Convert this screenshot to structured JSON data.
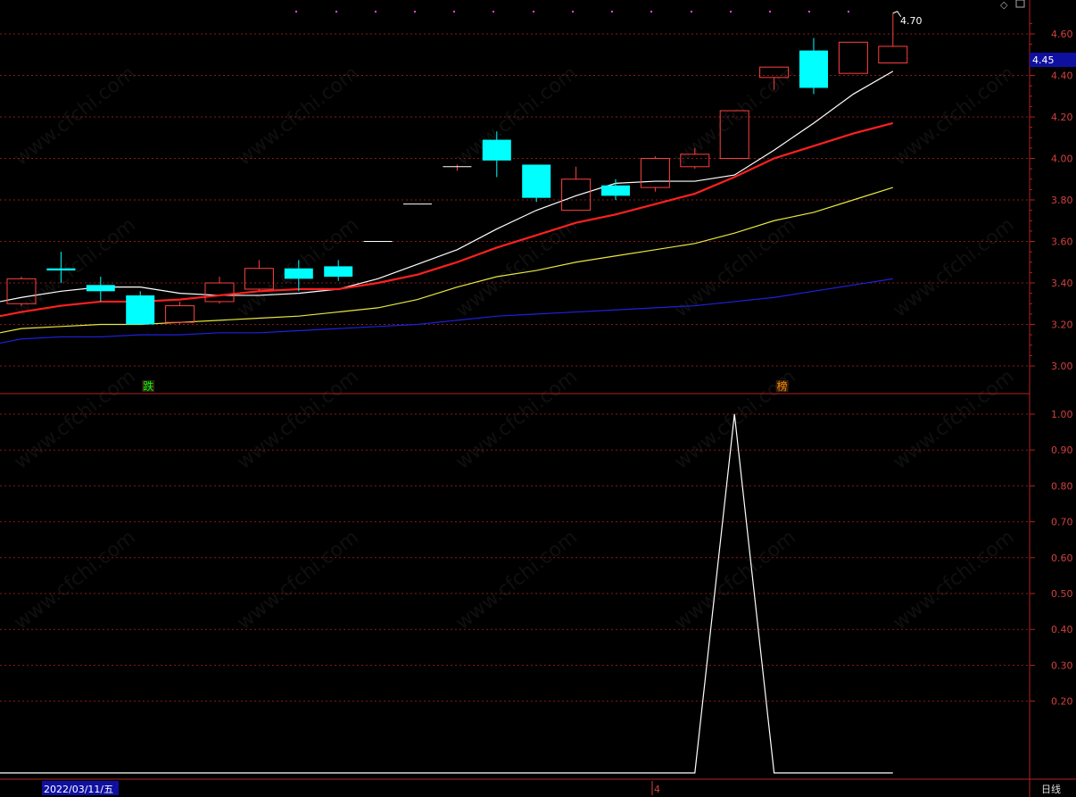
{
  "chart_data": {
    "type": "candlestick",
    "price_panel": {
      "ylim": [
        2.9,
        4.7
      ],
      "y_ticks": [
        "4.60",
        "4.40",
        "4.20",
        "4.00",
        "3.80",
        "3.60",
        "3.40",
        "3.20",
        "3.00"
      ],
      "y_tick_values": [
        4.6,
        4.4,
        4.2,
        4.0,
        3.8,
        3.6,
        3.4,
        3.2,
        3.0
      ],
      "current_price_label": "4.45",
      "current_price": 4.45,
      "high_marker_label": "4.70",
      "high_marker_value": 4.7,
      "candles": [
        {
          "o": 3.3,
          "h": 3.43,
          "l": 3.29,
          "c": 3.42
        },
        {
          "o": 3.47,
          "h": 3.55,
          "l": 3.4,
          "c": 3.46
        },
        {
          "o": 3.39,
          "h": 3.43,
          "l": 3.31,
          "c": 3.36
        },
        {
          "o": 3.34,
          "h": 3.36,
          "l": 3.2,
          "c": 3.2
        },
        {
          "o": 3.21,
          "h": 3.31,
          "l": 3.2,
          "c": 3.29
        },
        {
          "o": 3.31,
          "h": 3.43,
          "l": 3.3,
          "c": 3.4
        },
        {
          "o": 3.37,
          "h": 3.51,
          "l": 3.36,
          "c": 3.47
        },
        {
          "o": 3.47,
          "h": 3.51,
          "l": 3.36,
          "c": 3.42
        },
        {
          "o": 3.48,
          "h": 3.51,
          "l": 3.41,
          "c": 3.43
        },
        {
          "o": 3.6,
          "h": 3.6,
          "l": 3.6,
          "c": 3.6
        },
        {
          "o": 3.78,
          "h": 3.78,
          "l": 3.78,
          "c": 3.78
        },
        {
          "o": 3.96,
          "h": 3.97,
          "l": 3.94,
          "c": 3.96
        },
        {
          "o": 4.09,
          "h": 4.13,
          "l": 3.91,
          "c": 3.99
        },
        {
          "o": 3.97,
          "h": 3.97,
          "l": 3.79,
          "c": 3.81
        },
        {
          "o": 3.75,
          "h": 3.96,
          "l": 3.75,
          "c": 3.9
        },
        {
          "o": 3.87,
          "h": 3.9,
          "l": 3.8,
          "c": 3.82
        },
        {
          "o": 3.86,
          "h": 4.01,
          "l": 3.84,
          "c": 4.0
        },
        {
          "o": 3.96,
          "h": 4.05,
          "l": 3.95,
          "c": 4.02
        },
        {
          "o": 4.0,
          "h": 4.23,
          "l": 4.0,
          "c": 4.23
        },
        {
          "o": 4.39,
          "h": 4.44,
          "l": 4.33,
          "c": 4.44
        },
        {
          "o": 4.52,
          "h": 4.58,
          "l": 4.31,
          "c": 4.34
        },
        {
          "o": 4.41,
          "h": 4.56,
          "l": 4.41,
          "c": 4.56
        },
        {
          "o": 4.46,
          "h": 4.7,
          "l": 4.46,
          "c": 4.54
        }
      ],
      "moving_averages": [
        {
          "color": "#ffffff",
          "values": [
            3.33,
            3.36,
            3.38,
            3.38,
            3.35,
            3.34,
            3.34,
            3.35,
            3.37,
            3.42,
            3.49,
            3.56,
            3.66,
            3.75,
            3.82,
            3.88,
            3.89,
            3.89,
            3.92,
            4.04,
            4.17,
            4.31,
            4.42
          ]
        },
        {
          "color": "#ff2020",
          "values": [
            3.26,
            3.29,
            3.31,
            3.31,
            3.32,
            3.34,
            3.36,
            3.37,
            3.37,
            3.4,
            3.44,
            3.5,
            3.57,
            3.63,
            3.69,
            3.73,
            3.78,
            3.83,
            3.91,
            4.0,
            4.06,
            4.12,
            4.17
          ]
        },
        {
          "color": "#e8e840",
          "values": [
            3.18,
            3.19,
            3.2,
            3.2,
            3.21,
            3.22,
            3.23,
            3.24,
            3.26,
            3.28,
            3.32,
            3.38,
            3.43,
            3.46,
            3.5,
            3.53,
            3.56,
            3.59,
            3.64,
            3.7,
            3.74,
            3.8,
            3.86
          ]
        },
        {
          "color": "#2020e0",
          "values": [
            3.13,
            3.14,
            3.14,
            3.15,
            3.15,
            3.16,
            3.16,
            3.17,
            3.18,
            3.19,
            3.2,
            3.22,
            3.24,
            3.25,
            3.26,
            3.27,
            3.28,
            3.29,
            3.31,
            3.33,
            3.36,
            3.39,
            3.42
          ]
        }
      ],
      "top_markers": {
        "color": "#ff40ff",
        "count": 15
      },
      "annotations": [
        {
          "text": "跌",
          "index": 3,
          "color": "#00ff00"
        },
        {
          "text": "榜",
          "index": 19,
          "color": "#ff8800"
        }
      ]
    },
    "indicator_panel": {
      "ylim": [
        0,
        1.05
      ],
      "y_ticks": [
        "1.00",
        "0.90",
        "0.80",
        "0.70",
        "0.60",
        "0.50",
        "0.40",
        "0.30",
        "0.20"
      ],
      "y_tick_values": [
        1.0,
        0.9,
        0.8,
        0.7,
        0.6,
        0.5,
        0.4,
        0.3,
        0.2
      ],
      "values": [
        0,
        0,
        0,
        0,
        0,
        0,
        0,
        0,
        0,
        0,
        0,
        0,
        0,
        0,
        0,
        0,
        0,
        0,
        1,
        0,
        0,
        0,
        0
      ]
    },
    "x_axis": {
      "date_label": "2022/03/11/五",
      "month_label": "4",
      "period_label": "日线"
    }
  },
  "watermark": "www.cfchi.com",
  "colors": {
    "background": "#000000",
    "grid": "#8b1a1a",
    "border": "#b22222",
    "tick_text": "#d04040",
    "up_candle": "#ff4040",
    "down_candle": "#00ffff",
    "price_badge_bg": "#1010a0"
  }
}
